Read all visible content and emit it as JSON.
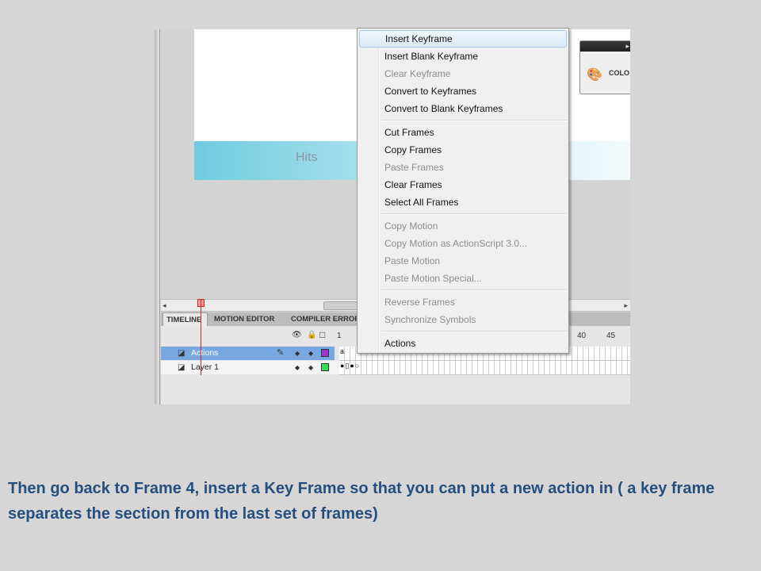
{
  "stage": {
    "banner_text": "Hits"
  },
  "color_panel": {
    "label": "COLO",
    "arrow": "▸",
    "icon": "palette-icon"
  },
  "tabs": [
    {
      "label": "TIMELINE",
      "active": true
    },
    {
      "label": "MOTION EDITOR",
      "active": false
    },
    {
      "label": "COMPILER ERROR",
      "active": false
    }
  ],
  "timeline": {
    "frame_numbers": [
      "1",
      "40",
      "45"
    ],
    "layers": [
      {
        "name": "Actions",
        "selected": true,
        "color": "#9933cc"
      },
      {
        "name": "Layer 1",
        "selected": false,
        "color": "#33dd55"
      }
    ]
  },
  "context_menu": {
    "groups": [
      [
        {
          "label": "Insert Keyframe",
          "enabled": true,
          "highlighted": true
        },
        {
          "label": "Insert Blank Keyframe",
          "enabled": true
        },
        {
          "label": "Clear Keyframe",
          "enabled": false
        },
        {
          "label": "Convert to Keyframes",
          "enabled": true
        },
        {
          "label": "Convert to Blank Keyframes",
          "enabled": true
        }
      ],
      [
        {
          "label": "Cut Frames",
          "enabled": true
        },
        {
          "label": "Copy Frames",
          "enabled": true
        },
        {
          "label": "Paste Frames",
          "enabled": false
        },
        {
          "label": "Clear Frames",
          "enabled": true
        },
        {
          "label": "Select All Frames",
          "enabled": true
        }
      ],
      [
        {
          "label": "Copy Motion",
          "enabled": false
        },
        {
          "label": "Copy Motion as ActionScript 3.0...",
          "enabled": false
        },
        {
          "label": "Paste Motion",
          "enabled": false
        },
        {
          "label": "Paste Motion Special...",
          "enabled": false
        }
      ],
      [
        {
          "label": "Reverse Frames",
          "enabled": false
        },
        {
          "label": "Synchronize Symbols",
          "enabled": false
        }
      ],
      [
        {
          "label": "Actions",
          "enabled": true
        }
      ]
    ]
  },
  "caption": "Then go back to Frame 4, insert a Key Frame so that you can put a new action in ( a key frame separates the section from the last set of frames)"
}
